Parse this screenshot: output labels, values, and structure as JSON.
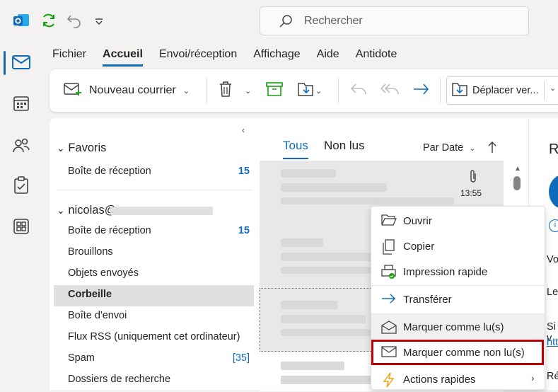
{
  "search": {
    "placeholder": "Rechercher"
  },
  "menu": {
    "items": [
      "Fichier",
      "Accueil",
      "Envoi/réception",
      "Affichage",
      "Aide",
      "Antidote"
    ]
  },
  "ribbon": {
    "new_mail": "Nouveau courrier",
    "move_to": "Déplacer ver..."
  },
  "folders": {
    "favorites_header": "Favoris",
    "favorites": [
      {
        "label": "Boîte de réception",
        "count": "15"
      }
    ],
    "account_header": "nicolas@",
    "items": [
      {
        "label": "Boîte de réception",
        "count": "15"
      },
      {
        "label": "Brouillons",
        "count": ""
      },
      {
        "label": "Objets envoyés",
        "count": ""
      },
      {
        "label": "Corbeille",
        "count": ""
      },
      {
        "label": "Boîte d'envoi",
        "count": ""
      },
      {
        "label": "Flux RSS (uniquement cet ordinateur)",
        "count": ""
      },
      {
        "label": "Spam",
        "count": "[35]"
      },
      {
        "label": "Dossiers de recherche",
        "count": ""
      }
    ]
  },
  "list": {
    "tab_all": "Tous",
    "tab_unread": "Non lus",
    "sort": "Par Date",
    "first_time": "13:55"
  },
  "reading": {
    "frag1": "R",
    "frag2": "Vot",
    "frag3": "Les",
    "frag4": "Si v",
    "frag5": "htt",
    "frag6": "Rés"
  },
  "context_menu": {
    "items": [
      "Ouvrir",
      "Copier",
      "Impression rapide",
      "Transférer",
      "Marquer comme lu(s)",
      "Marquer comme non lu(s)",
      "Actions rapides"
    ]
  },
  "colors": {
    "accent": "#0f6cbd",
    "highlight_box": "#c00000"
  }
}
